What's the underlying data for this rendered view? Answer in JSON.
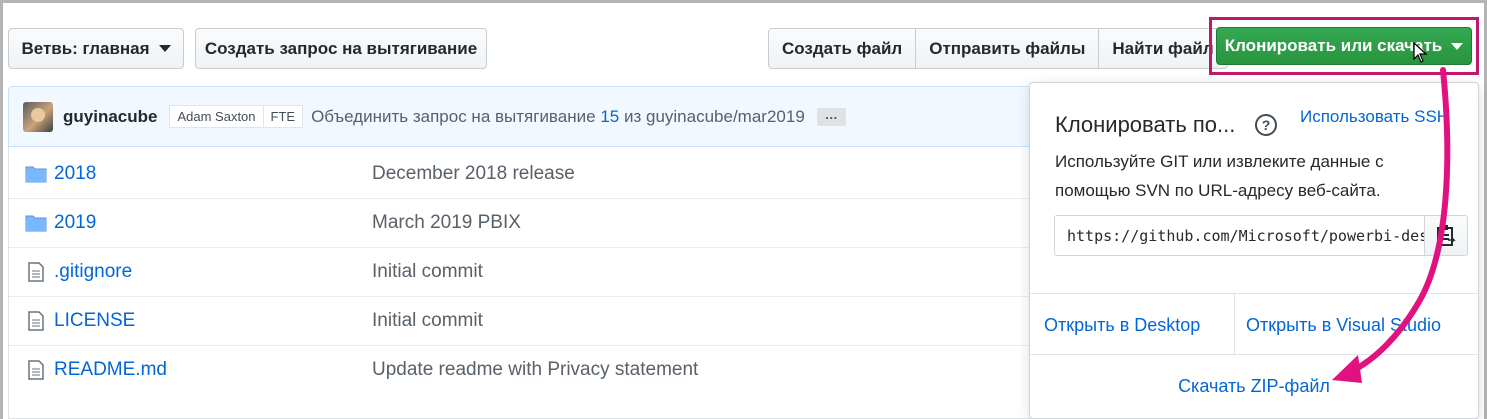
{
  "toolbar": {
    "branch_label": "Ветвь: главная",
    "new_pull_request": "Создать запрос на вытягивание",
    "create_file": "Создать файл",
    "upload_files": "Отправить файлы",
    "find_file": "Найти файл",
    "clone_download": "Клонировать или скачать"
  },
  "commit": {
    "author": "guyinacube",
    "coauthor_tag": "Adam Saxton",
    "fte_tag": "FTE",
    "message_prefix": "Объединить запрос на вытягивание",
    "pr_number": "15",
    "message_from": "из",
    "branch_ref": "guyinacube/mar2019",
    "ellipsis": "…"
  },
  "files": [
    {
      "name": "2018",
      "type": "folder",
      "message": "December 2018 release"
    },
    {
      "name": "2019",
      "type": "folder",
      "message": "March 2019 PBIX"
    },
    {
      "name": ".gitignore",
      "type": "file",
      "message": "Initial commit"
    },
    {
      "name": "LICENSE",
      "type": "file",
      "message": "Initial commit"
    },
    {
      "name": "README.md",
      "type": "file",
      "message": "Update readme with Privacy statement"
    }
  ],
  "clone_panel": {
    "title": "Клонировать по...",
    "help_icon": "question-icon",
    "ssh_link": "Использовать SSH",
    "description": "Используйте GIT или извлеките данные с помощью SVN по URL-адресу веб-сайта.",
    "url_value": "https://github.com/Microsoft/powerbi-desktop-samples.git",
    "copy_icon": "clipboard-icon",
    "open_desktop": "Открыть в Desktop",
    "open_visual_studio": "Открыть в Visual Studio",
    "download_zip": "Скачать ZIP-файл"
  },
  "colors": {
    "accent_link": "#0366d6",
    "green_button": "#2ea44f",
    "annotation_magenta": "#e0127f"
  }
}
